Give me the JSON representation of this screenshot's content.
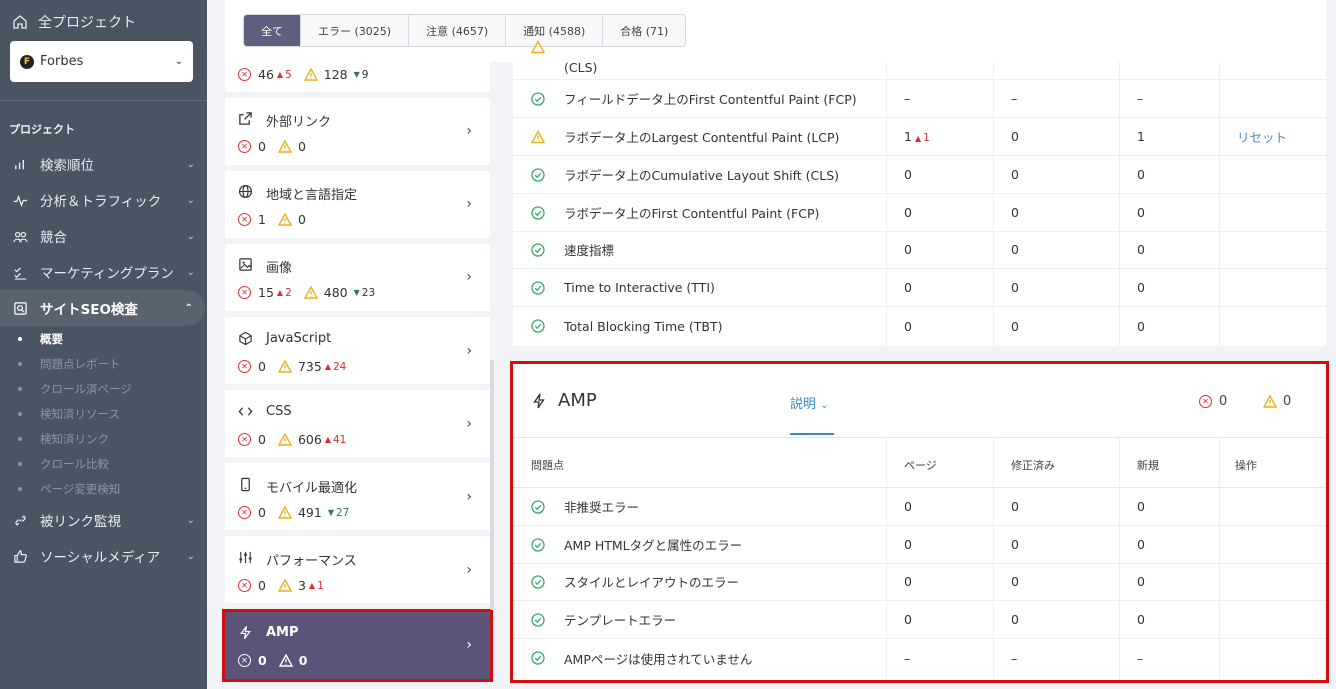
{
  "sidebar": {
    "all_projects": "全プロジェクト",
    "project": "Forbes",
    "section_title": "プロジェクト",
    "items": [
      {
        "label": "検索順位",
        "icon": "bar-chart-icon"
      },
      {
        "label": "分析＆トラフィック",
        "icon": "pulse-icon"
      },
      {
        "label": "競合",
        "icon": "users-icon"
      },
      {
        "label": "マーケティングプラン",
        "icon": "checklist-icon"
      },
      {
        "label": "サイトSEO検査",
        "icon": "audit-icon"
      }
    ],
    "sub_items": [
      "概要",
      "問題点レポート",
      "クロール済ページ",
      "検知済リソース",
      "検知済リンク",
      "クロール比較",
      "ページ変更検知"
    ],
    "items2": [
      {
        "label": "被リンク監視",
        "icon": "link-icon"
      },
      {
        "label": "ソーシャルメディア",
        "icon": "thumbs-up-icon"
      }
    ]
  },
  "tabs": [
    "全て",
    "エラー (3025)",
    "注意 (4657)",
    "通知 (4588)",
    "合格 (71)"
  ],
  "cards": {
    "partial": {
      "err": "46",
      "err_up": "5",
      "warn": "128",
      "warn_dn": "9"
    },
    "external": {
      "title": "外部リンク",
      "err": "0",
      "warn": "0"
    },
    "geo": {
      "title": "地域と言語指定",
      "err": "1",
      "warn": "0"
    },
    "images": {
      "title": "画像",
      "err": "15",
      "err_up": "2",
      "warn": "480",
      "warn_dn": "23"
    },
    "js": {
      "title": "JavaScript",
      "err": "0",
      "warn": "735",
      "warn_up": "24"
    },
    "css": {
      "title": "CSS",
      "err": "0",
      "warn": "606",
      "warn_up": "41"
    },
    "mobile": {
      "title": "モバイル最適化",
      "err": "0",
      "warn": "491",
      "warn_dn": "27"
    },
    "perf": {
      "title": "パフォーマンス",
      "err": "0",
      "warn": "3",
      "warn_up": "1"
    },
    "amp": {
      "title": "AMP",
      "err": "0",
      "warn": "0"
    }
  },
  "top_table": {
    "partial_label": "(CLS)",
    "rows": [
      {
        "name": "フィールドデータ上のFirst Contentful Paint (FCP)",
        "c1": "–",
        "c2": "–",
        "c3": "–",
        "c4": "",
        "status": "pass"
      },
      {
        "name": "ラボデータ上のLargest Contentful Paint (LCP)",
        "c1": "1",
        "c1_up": "1",
        "c2": "0",
        "c3": "1",
        "c4": "リセット",
        "status": "warn"
      },
      {
        "name": "ラボデータ上のCumulative Layout Shift (CLS)",
        "c1": "0",
        "c2": "0",
        "c3": "0",
        "c4": "",
        "status": "pass"
      },
      {
        "name": "ラボデータ上のFirst Contentful Paint (FCP)",
        "c1": "0",
        "c2": "0",
        "c3": "0",
        "c4": "",
        "status": "pass"
      },
      {
        "name": "速度指標",
        "c1": "0",
        "c2": "0",
        "c3": "0",
        "c4": "",
        "status": "pass"
      },
      {
        "name": "Time to Interactive (TTI)",
        "c1": "0",
        "c2": "0",
        "c3": "0",
        "c4": "",
        "status": "pass"
      },
      {
        "name": "Total Blocking Time (TBT)",
        "c1": "0",
        "c2": "0",
        "c3": "0",
        "c4": "",
        "status": "pass"
      }
    ]
  },
  "amp_section": {
    "title": "AMP",
    "desc_label": "説明",
    "err_count": "0",
    "warn_count": "0",
    "headers": [
      "問題点",
      "ページ",
      "修正済み",
      "新規",
      "操作"
    ],
    "rows": [
      {
        "name": "非推奨エラー",
        "c1": "0",
        "c2": "0",
        "c3": "0"
      },
      {
        "name": "AMP HTMLタグと属性のエラー",
        "c1": "0",
        "c2": "0",
        "c3": "0"
      },
      {
        "name": "スタイルとレイアウトのエラー",
        "c1": "0",
        "c2": "0",
        "c3": "0"
      },
      {
        "name": "テンプレートエラー",
        "c1": "0",
        "c2": "0",
        "c3": "0"
      },
      {
        "name": "AMPページは使用されていません",
        "c1": "–",
        "c2": "–",
        "c3": "–"
      }
    ]
  },
  "colors": {
    "sidebar": "#4a5564",
    "accent": "#5c5379",
    "error": "#d9302f",
    "warning": "#e8b21a",
    "pass": "#3aa86a",
    "highlight": "#d20e0e"
  }
}
